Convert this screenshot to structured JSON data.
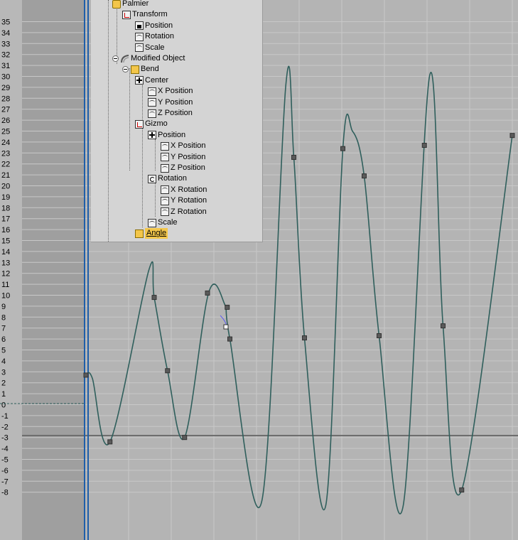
{
  "y_axis": {
    "ticks": [
      "35",
      "34",
      "33",
      "32",
      "31",
      "30",
      "29",
      "28",
      "27",
      "26",
      "25",
      "24",
      "23",
      "22",
      "21",
      "20",
      "19",
      "18",
      "17",
      "16",
      "15",
      "14",
      "13",
      "12",
      "11",
      "10",
      "9",
      "8",
      "7",
      "6",
      "5",
      "4",
      "3",
      "2",
      "1",
      "0",
      "-1",
      "-2",
      "-3",
      "-4",
      "-5",
      "-6",
      "-7",
      "-8"
    ]
  },
  "tree": {
    "items": [
      {
        "label": "Palmier",
        "icon": "object-icon"
      },
      {
        "label": "Transform",
        "icon": "transform-icon"
      },
      {
        "label": "Position",
        "icon": "lock-icon"
      },
      {
        "label": "Rotation",
        "icon": "curve-icon"
      },
      {
        "label": "Scale",
        "icon": "curve-icon"
      },
      {
        "label": "Modified Object",
        "icon": "modifier-icon"
      },
      {
        "label": "Bend",
        "icon": "bend-icon"
      },
      {
        "label": "Center",
        "icon": "move-icon"
      },
      {
        "label": "X Position",
        "icon": "curve-icon"
      },
      {
        "label": "Y Position",
        "icon": "curve-icon"
      },
      {
        "label": "Z Position",
        "icon": "curve-icon"
      },
      {
        "label": "Gizmo",
        "icon": "gizmo-icon"
      },
      {
        "label": "Position",
        "icon": "move-icon"
      },
      {
        "label": "X Position",
        "icon": "curve-icon"
      },
      {
        "label": "Y Position",
        "icon": "curve-icon"
      },
      {
        "label": "Z Position",
        "icon": "curve-icon"
      },
      {
        "label": "Rotation",
        "icon": "rotation-icon"
      },
      {
        "label": "X Rotation",
        "icon": "curve-icon"
      },
      {
        "label": "Y Rotation",
        "icon": "curve-icon"
      },
      {
        "label": "Z Rotation",
        "icon": "curve-icon"
      },
      {
        "label": "Scale",
        "icon": "curve-icon"
      },
      {
        "label": "Angle",
        "icon": "angle-icon"
      }
    ],
    "selected_label": "Angle"
  },
  "curve": {
    "color": "#2f5f5c",
    "key_color": "#5a5a5a",
    "keys": [
      [
        0,
        2.7
      ],
      [
        4.5,
        -3.4
      ],
      [
        12.8,
        9.8
      ],
      [
        15.3,
        3.1
      ],
      [
        18.5,
        -3.0
      ],
      [
        22.8,
        10.2
      ],
      [
        26.5,
        8.9
      ],
      [
        27.0,
        6.0
      ],
      [
        39.0,
        22.6
      ],
      [
        41.0,
        6.1
      ],
      [
        48.2,
        23.4
      ],
      [
        52.2,
        20.9
      ],
      [
        55.0,
        6.3
      ],
      [
        63.5,
        23.7
      ],
      [
        67.0,
        7.2
      ],
      [
        70.5,
        -7.8
      ],
      [
        80.0,
        24.6
      ]
    ],
    "peaks": [
      [
        0,
        2.7
      ],
      [
        1.2,
        2.4
      ],
      [
        4.5,
        -3.4
      ],
      [
        11.8,
        12.3
      ],
      [
        12.8,
        9.8
      ],
      [
        15.3,
        3.1
      ],
      [
        18.5,
        -3.0
      ],
      [
        23.0,
        10.2
      ],
      [
        26.0,
        9.2
      ],
      [
        27.0,
        6.0
      ],
      [
        33.0,
        -8.8
      ],
      [
        37.5,
        29.2
      ],
      [
        39.0,
        22.6
      ],
      [
        41.0,
        6.1
      ],
      [
        45.0,
        -9.2
      ],
      [
        48.2,
        23.4
      ],
      [
        50.0,
        25.0
      ],
      [
        52.2,
        20.9
      ],
      [
        55.0,
        6.3
      ],
      [
        59.5,
        -9.3
      ],
      [
        64.5,
        30.1
      ],
      [
        67.0,
        7.2
      ],
      [
        70.5,
        -7.8
      ],
      [
        80.0,
        24.6
      ]
    ]
  },
  "grid": {
    "background": "#b4b4b4",
    "inactive_background": "#9f9f9f",
    "line_color": "#c8c8c8",
    "zero_line_color": "#6e6e6e",
    "frame_marker_color": "#1f5ea8"
  }
}
